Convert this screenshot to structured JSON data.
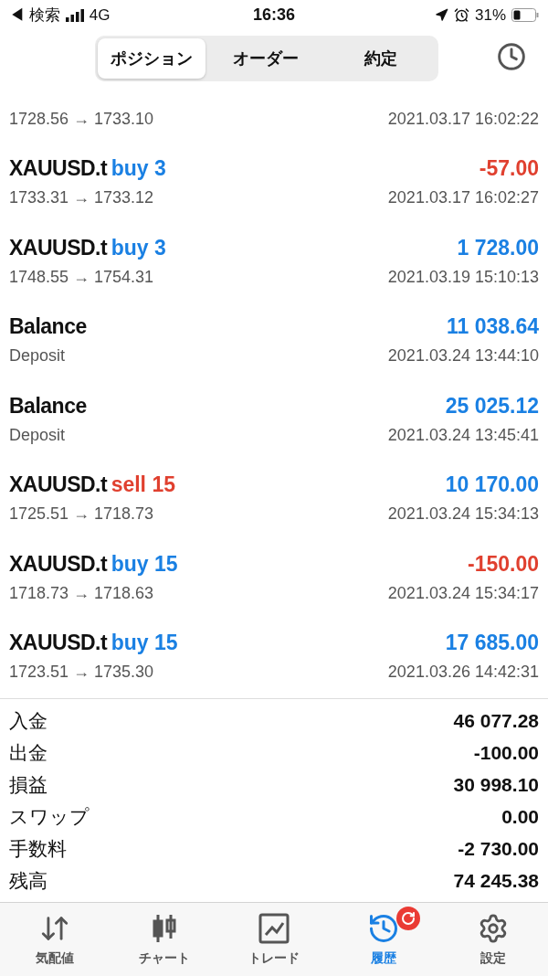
{
  "status_bar": {
    "back": "◀ 検索",
    "network": "4G",
    "time": "16:36",
    "battery": "31%"
  },
  "segments": [
    {
      "label": "ポジション",
      "selected": true
    },
    {
      "label": "オーダー",
      "selected": false
    },
    {
      "label": "約定",
      "selected": false
    }
  ],
  "deals": [
    {
      "kind": "trade",
      "prices": "1728.56 → 1733.10",
      "time": "2021.03.17 16:02:22"
    },
    {
      "kind": "trade",
      "symbol": "XAUUSD.t",
      "action": "buy 3",
      "sell": false,
      "profit": "-57.00",
      "negative": true,
      "prices": "1733.31 → 1733.12",
      "time": "2021.03.17 16:02:27"
    },
    {
      "kind": "trade",
      "symbol": "XAUUSD.t",
      "action": "buy 3",
      "sell": false,
      "profit": "1 728.00",
      "negative": false,
      "prices": "1748.55 → 1754.31",
      "time": "2021.03.19 15:10:13"
    },
    {
      "kind": "balance",
      "symbol": "Balance",
      "profit": "11 038.64",
      "negative": false,
      "prices": "Deposit",
      "time": "2021.03.24 13:44:10"
    },
    {
      "kind": "balance",
      "symbol": "Balance",
      "profit": "25 025.12",
      "negative": false,
      "prices": "Deposit",
      "time": "2021.03.24 13:45:41"
    },
    {
      "kind": "trade",
      "symbol": "XAUUSD.t",
      "action": "sell 15",
      "sell": true,
      "profit": "10 170.00",
      "negative": false,
      "prices": "1725.51 → 1718.73",
      "time": "2021.03.24 15:34:13"
    },
    {
      "kind": "trade",
      "symbol": "XAUUSD.t",
      "action": "buy 15",
      "sell": false,
      "profit": "-150.00",
      "negative": true,
      "prices": "1718.73 → 1718.63",
      "time": "2021.03.24 15:34:17"
    },
    {
      "kind": "trade",
      "symbol": "XAUUSD.t",
      "action": "buy 15",
      "sell": false,
      "profit": "17 685.00",
      "negative": false,
      "prices": "1723.51 → 1735.30",
      "time": "2021.03.26 14:42:31"
    }
  ],
  "summary": [
    {
      "label": "入金",
      "value": "46 077.28"
    },
    {
      "label": "出金",
      "value": "-100.00"
    },
    {
      "label": "損益",
      "value": "30 998.10"
    },
    {
      "label": "スワップ",
      "value": "0.00"
    },
    {
      "label": "手数料",
      "value": "-2 730.00"
    },
    {
      "label": "残高",
      "value": "74 245.38"
    }
  ],
  "tab_bar": [
    {
      "kind": "quotes",
      "label": "気配値",
      "selected": false
    },
    {
      "kind": "chart",
      "label": "チャート",
      "selected": false
    },
    {
      "kind": "trade",
      "label": "トレード",
      "selected": false
    },
    {
      "kind": "history",
      "label": "履歴",
      "selected": true
    },
    {
      "kind": "settings",
      "label": "設定",
      "selected": false
    }
  ]
}
